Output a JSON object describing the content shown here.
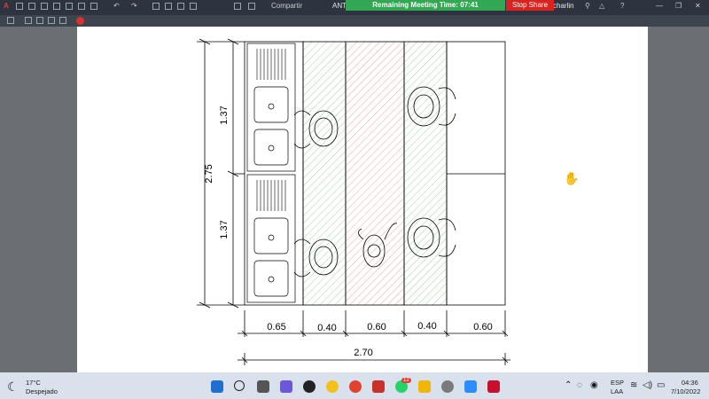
{
  "titlebar": {
    "share_label": "Compartir",
    "doc_title": "ANT",
    "user": "charlin",
    "meeting_label": "Remaining Meeting Time: 07:41",
    "stop_share_label": "Stop Share"
  },
  "drawing": {
    "dim_labels_vertical": [
      "2.75",
      "1.37",
      "1.37"
    ],
    "dim_labels_bottom": [
      "0.65",
      "0.40",
      "0.60",
      "0.40",
      "0.60"
    ],
    "dim_total": "2.70"
  },
  "taskbar": {
    "weather_temp": "17°C",
    "weather_desc": "Despejado",
    "lang_top": "ESP",
    "lang_bottom": "LAA",
    "time": "04:36",
    "date": "7/10/2022",
    "whatsapp_badge": "12"
  },
  "colors": {
    "meeting_bar": "#32a852",
    "stop_share": "#d9231f",
    "hatch_green": "#9fd49f",
    "hatch_red": "#e8a3a3"
  }
}
